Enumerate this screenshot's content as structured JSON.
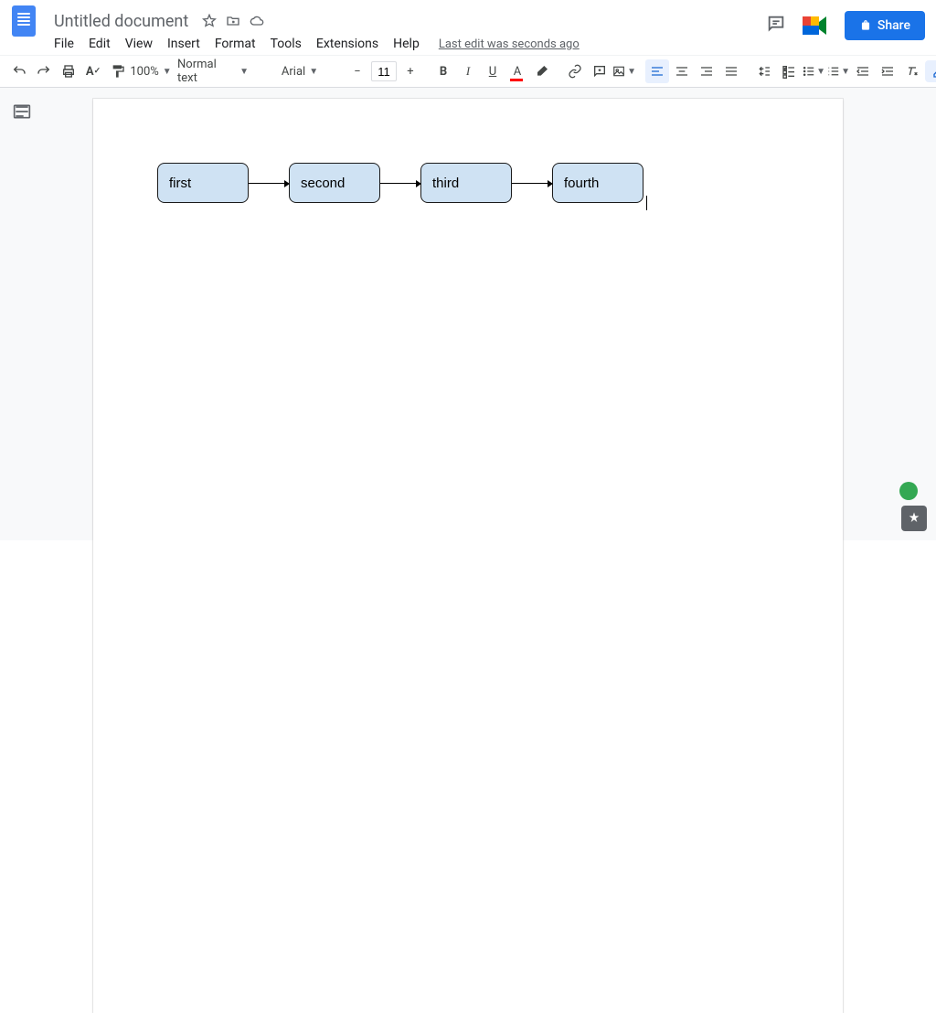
{
  "doc": {
    "title": "Untitled document",
    "last_edit": "Last edit was seconds ago"
  },
  "menu": {
    "file": "File",
    "edit": "Edit",
    "view": "View",
    "insert": "Insert",
    "format": "Format",
    "tools": "Tools",
    "extensions": "Extensions",
    "help": "Help"
  },
  "toolbar": {
    "zoom": "100%",
    "style": "Normal text",
    "font": "Arial",
    "fontSize": "11"
  },
  "share": {
    "label": "Share"
  },
  "diagram": {
    "boxes": [
      "first",
      "second",
      "third",
      "fourth"
    ]
  }
}
